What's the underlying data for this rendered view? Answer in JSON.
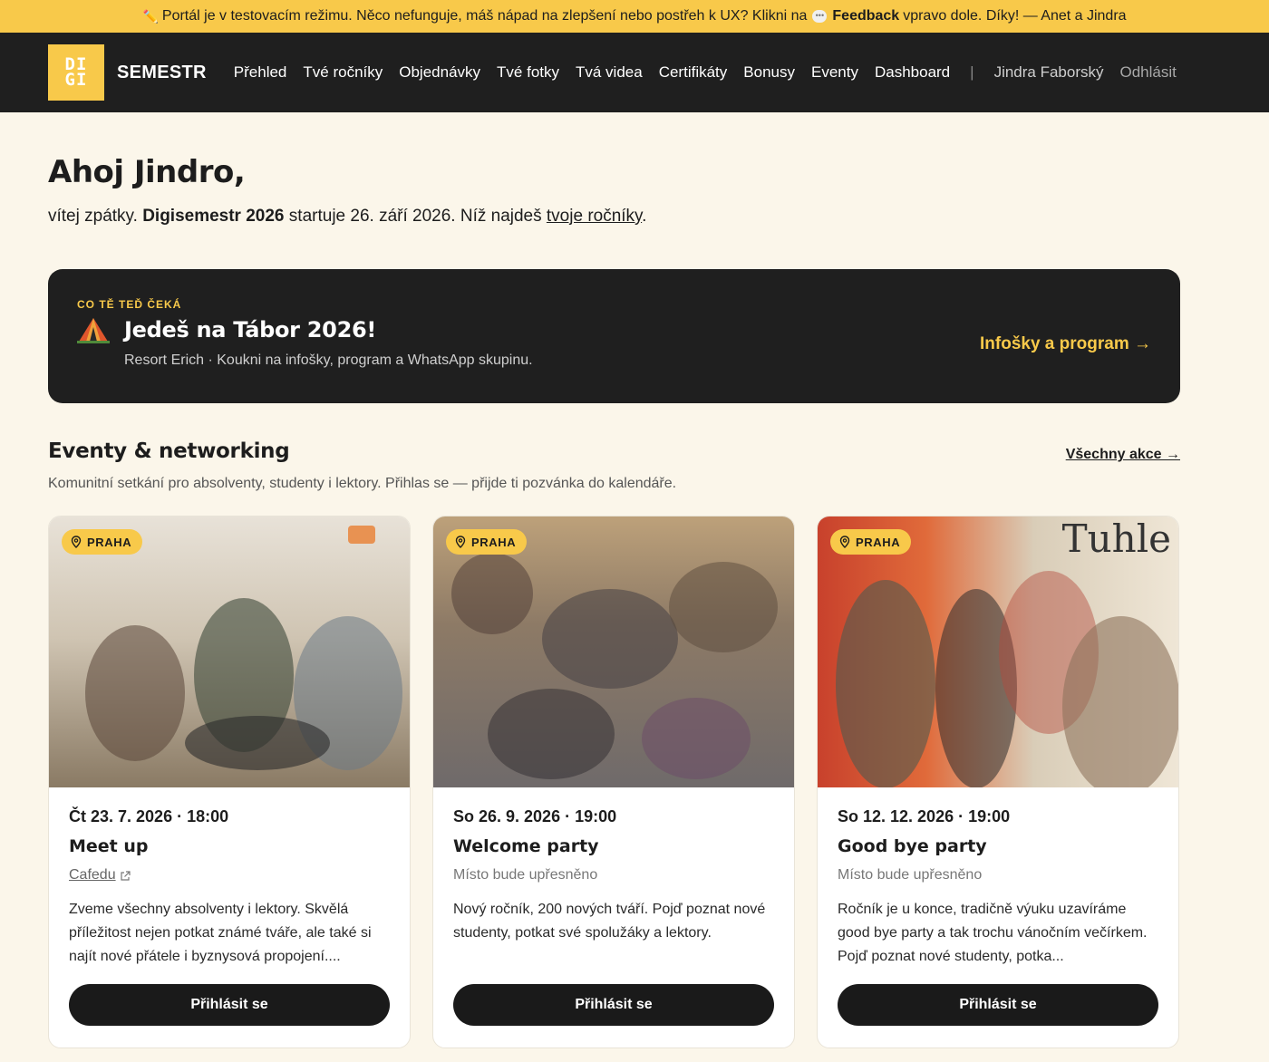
{
  "banner": {
    "text_before": "Portál je v testovacím režimu. Něco nefunguje, máš nápad na zlepšení nebo postřeh k UX? Klikni na",
    "feedback_label": "Feedback",
    "text_after": "vpravo dole. Díky! — Anet a Jindra"
  },
  "header": {
    "logo_line1": "DI",
    "logo_line2": "GI",
    "brand": "SEMESTR",
    "nav": [
      "Přehled",
      "Tvé ročníky",
      "Objednávky",
      "Tvé fotky",
      "Tvá videa",
      "Certifikáty",
      "Bonusy",
      "Eventy",
      "Dashboard"
    ],
    "separator": "|",
    "user_name": "Jindra Faborský",
    "logout_label": "Odhlásit"
  },
  "greeting": {
    "title": "Ahoj Jindro,",
    "welcome_prefix": "vítej zpátky.",
    "program_name": "Digisemestr 2026",
    "welcome_middle": "startuje 26. září 2026. Níž najdeš",
    "link_label": "tvoje ročníky",
    "welcome_suffix": "."
  },
  "promo": {
    "eyebrow": "CO TĚ TEĎ ČEKÁ",
    "title": "Jedeš na Tábor 2026!",
    "subtitle": "Resort Erich · Koukni na infošky, program a WhatsApp skupinu.",
    "link_label": "Infošky a program →",
    "icon": "tent-icon"
  },
  "events_section": {
    "title": "Eventy & networking",
    "subtitle": "Komunitní setkání pro absolventy, studenty i lektory. Přihlas se — přijde ti pozvánka do kalendáře.",
    "all_link": "Všechny akce →"
  },
  "events": [
    {
      "city": "PRAHA",
      "date": "Čt 23. 7. 2026 · 18:00",
      "title": "Meet up",
      "venue": "Cafedu",
      "venue_is_link": true,
      "description": "Zveme všechny absolventy i lektory. Skvělá příležitost nejen potkat známé tváře, ale také si najít nové přátele i byznysová propojení....",
      "button": "Přihlásit se"
    },
    {
      "city": "PRAHA",
      "date": "So 26. 9. 2026 · 19:00",
      "title": "Welcome party",
      "venue": "Místo bude upřesněno",
      "venue_is_link": false,
      "description": "Nový ročník, 200 nových tváří. Pojď poznat nové studenty, potkat své spolužáky a lektory.",
      "button": "Přihlásit se"
    },
    {
      "city": "PRAHA",
      "date": "So 12. 12. 2026 · 19:00",
      "title": "Good bye party",
      "venue": "Místo bude upřesněno",
      "venue_is_link": false,
      "description": "Ročník je u konce, tradičně výuku uzavíráme good bye party a tak trochu vánočním večírkem. Pojď poznat nové studenty, potka...",
      "button": "Přihlásit se"
    }
  ],
  "photo_signage": "Tuhle",
  "colors": {
    "accent": "#f8c94a",
    "dark": "#1f1f1f",
    "background": "#fbf6ea"
  }
}
